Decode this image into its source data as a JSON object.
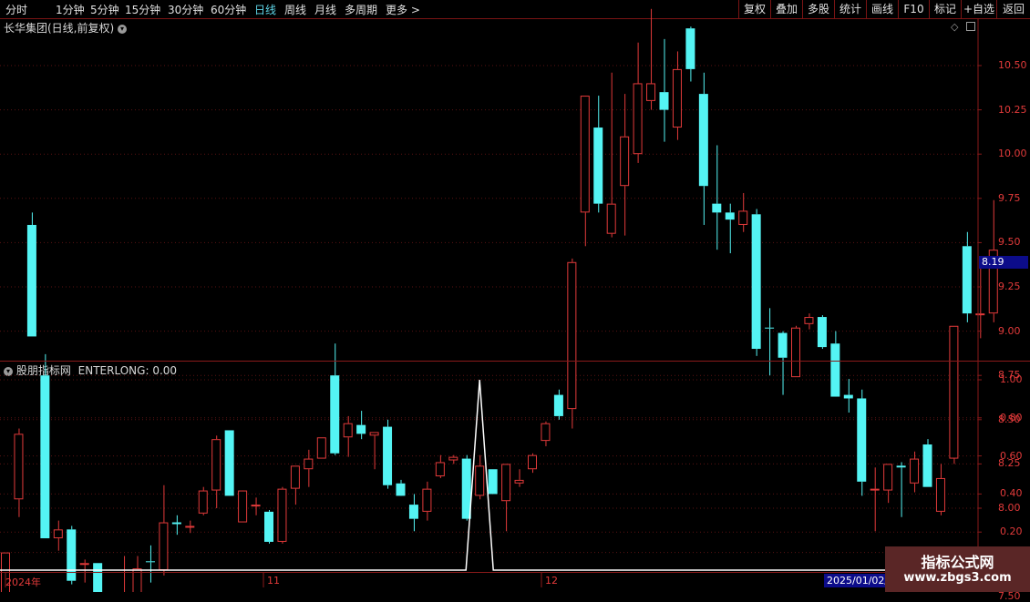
{
  "toolbar": {
    "periods": [
      "分时",
      "1分钟",
      "5分钟",
      "15分钟",
      "30分钟",
      "60分钟",
      "日线",
      "周线",
      "月线",
      "多周期",
      "更多 >"
    ],
    "active_period": "日线",
    "right_buttons": [
      "复权",
      "叠加",
      "多股",
      "统计",
      "画线",
      "F10",
      "标记",
      "+自选",
      "返回"
    ]
  },
  "main_panel": {
    "title": "长华集团(日线,前复权)",
    "current_price_tag": "8.19",
    "y_ticks": [
      "10.50",
      "10.25",
      "10.00",
      "9.75",
      "9.50",
      "9.25",
      "9.00",
      "8.75",
      "8.50",
      "8.25",
      "8.00",
      "7.75",
      "7.50"
    ]
  },
  "indicator_panel": {
    "title": "股朋指标网",
    "indicator_label": "ENTERLONG: 0.00",
    "y_ticks": [
      "1.00",
      "0.80",
      "0.60",
      "0.40",
      "0.20"
    ]
  },
  "x_axis": {
    "labels": [
      "2024年",
      "11",
      "12"
    ],
    "cursor_date": "2025/01/02/"
  },
  "watermark": {
    "line1": "指标公式网",
    "line2": "www.zbgs3.com"
  },
  "colors": {
    "up": "#e23a3a",
    "down": "#54f4f4",
    "signal": "#ffffff",
    "axis": "#8a1a1a"
  },
  "chart_data": [
    {
      "type": "candlestick",
      "title": "长华集团(日线,前复权)",
      "ylim": [
        7.3,
        10.8
      ],
      "candles": [
        {
          "o": 7.48,
          "h": 7.75,
          "l": 7.48,
          "c": 7.75,
          "up": true
        },
        {
          "o": 8.05,
          "h": 8.45,
          "l": 7.95,
          "c": 8.42,
          "up": true
        },
        {
          "o": 9.6,
          "h": 9.67,
          "l": 8.97,
          "c": 8.97,
          "up": false
        },
        {
          "o": 8.75,
          "h": 8.87,
          "l": 7.83,
          "c": 7.83,
          "up": false
        },
        {
          "o": 7.83,
          "h": 7.93,
          "l": 7.76,
          "c": 7.88,
          "up": true
        },
        {
          "o": 7.88,
          "h": 7.9,
          "l": 7.57,
          "c": 7.59,
          "up": false
        },
        {
          "o": 7.69,
          "h": 7.71,
          "l": 7.58,
          "c": 7.69,
          "up": true
        },
        {
          "o": 7.69,
          "h": 7.69,
          "l": 7.51,
          "c": 7.52,
          "up": false
        },
        {
          "o": 7.42,
          "h": 7.52,
          "l": 7.38,
          "c": 7.5,
          "up": true
        },
        {
          "o": 7.47,
          "h": 7.73,
          "l": 7.44,
          "c": 7.49,
          "up": true
        },
        {
          "o": 7.48,
          "h": 7.73,
          "l": 7.48,
          "c": 7.66,
          "up": true
        },
        {
          "o": 7.7,
          "h": 7.79,
          "l": 7.58,
          "c": 7.7,
          "up": false
        },
        {
          "o": 7.65,
          "h": 8.13,
          "l": 7.62,
          "c": 7.92,
          "up": true
        },
        {
          "o": 7.92,
          "h": 7.96,
          "l": 7.85,
          "c": 7.91,
          "up": false
        },
        {
          "o": 7.9,
          "h": 7.93,
          "l": 7.86,
          "c": 7.9,
          "up": true
        },
        {
          "o": 7.97,
          "h": 8.12,
          "l": 7.96,
          "c": 8.1,
          "up": true
        },
        {
          "o": 8.1,
          "h": 8.41,
          "l": 8.0,
          "c": 8.39,
          "up": true
        },
        {
          "o": 8.44,
          "h": 8.44,
          "l": 8.07,
          "c": 8.07,
          "up": false
        },
        {
          "o": 7.92,
          "h": 8.07,
          "l": 7.92,
          "c": 8.1,
          "up": true
        },
        {
          "o": 8.02,
          "h": 8.06,
          "l": 7.96,
          "c": 8.02,
          "up": true
        },
        {
          "o": 7.98,
          "h": 7.99,
          "l": 7.8,
          "c": 7.81,
          "up": false
        },
        {
          "o": 7.81,
          "h": 8.12,
          "l": 7.8,
          "c": 8.11,
          "up": true
        },
        {
          "o": 8.11,
          "h": 8.24,
          "l": 8.02,
          "c": 8.24,
          "up": true
        },
        {
          "o": 8.22,
          "h": 8.33,
          "l": 8.12,
          "c": 8.28,
          "up": true
        },
        {
          "o": 8.28,
          "h": 8.4,
          "l": 8.28,
          "c": 8.4,
          "up": true
        },
        {
          "o": 8.75,
          "h": 8.93,
          "l": 8.3,
          "c": 8.31,
          "up": false
        },
        {
          "o": 8.4,
          "h": 8.52,
          "l": 8.29,
          "c": 8.48,
          "up": true
        },
        {
          "o": 8.47,
          "h": 8.55,
          "l": 8.39,
          "c": 8.42,
          "up": false
        },
        {
          "o": 8.41,
          "h": 8.43,
          "l": 8.22,
          "c": 8.43,
          "up": true
        },
        {
          "o": 8.46,
          "h": 8.5,
          "l": 8.11,
          "c": 8.13,
          "up": false
        },
        {
          "o": 8.14,
          "h": 8.16,
          "l": 8.09,
          "c": 8.07,
          "up": false
        },
        {
          "o": 8.02,
          "h": 8.08,
          "l": 7.87,
          "c": 7.94,
          "up": false
        },
        {
          "o": 7.98,
          "h": 8.15,
          "l": 7.93,
          "c": 8.11,
          "up": true
        },
        {
          "o": 8.18,
          "h": 8.3,
          "l": 8.17,
          "c": 8.26,
          "up": true
        },
        {
          "o": 8.27,
          "h": 8.3,
          "l": 8.25,
          "c": 8.29,
          "up": true
        },
        {
          "o": 8.28,
          "h": 8.3,
          "l": 7.93,
          "c": 7.94,
          "up": false
        },
        {
          "o": 8.07,
          "h": 8.3,
          "l": 8.05,
          "c": 8.24,
          "up": true
        },
        {
          "o": 8.22,
          "h": 8.22,
          "l": 8.08,
          "c": 8.08,
          "up": false
        },
        {
          "o": 8.04,
          "h": 8.25,
          "l": 7.87,
          "c": 8.25,
          "up": true
        },
        {
          "o": 8.14,
          "h": 8.22,
          "l": 8.12,
          "c": 8.16,
          "up": true
        },
        {
          "o": 8.22,
          "h": 8.31,
          "l": 8.2,
          "c": 8.3,
          "up": true
        },
        {
          "o": 8.38,
          "h": 8.49,
          "l": 8.35,
          "c": 8.48,
          "up": true
        },
        {
          "o": 8.64,
          "h": 8.67,
          "l": 8.5,
          "c": 8.52,
          "up": false
        },
        {
          "o": 8.56,
          "h": 9.41,
          "l": 8.45,
          "c": 9.39,
          "up": true
        },
        {
          "o": 9.67,
          "h": 10.3,
          "l": 9.48,
          "c": 10.33,
          "up": true
        },
        {
          "o": 10.15,
          "h": 10.33,
          "l": 9.67,
          "c": 9.72,
          "up": false
        },
        {
          "o": 9.55,
          "h": 10.46,
          "l": 9.53,
          "c": 9.72,
          "up": true
        },
        {
          "o": 9.82,
          "h": 10.34,
          "l": 9.54,
          "c": 10.1,
          "up": true
        },
        {
          "o": 10.0,
          "h": 10.63,
          "l": 9.95,
          "c": 10.4,
          "up": true
        },
        {
          "o": 10.3,
          "h": 10.82,
          "l": 10.25,
          "c": 10.4,
          "up": true
        },
        {
          "o": 10.35,
          "h": 10.65,
          "l": 10.07,
          "c": 10.25,
          "up": false
        },
        {
          "o": 10.15,
          "h": 10.58,
          "l": 10.08,
          "c": 10.48,
          "up": true
        },
        {
          "o": 10.71,
          "h": 10.72,
          "l": 10.41,
          "c": 10.48,
          "up": false
        },
        {
          "o": 10.34,
          "h": 10.46,
          "l": 9.6,
          "c": 9.82,
          "up": false
        },
        {
          "o": 9.72,
          "h": 10.05,
          "l": 9.46,
          "c": 9.67,
          "up": false
        },
        {
          "o": 9.67,
          "h": 9.72,
          "l": 9.44,
          "c": 9.63,
          "up": false
        },
        {
          "o": 9.6,
          "h": 9.78,
          "l": 9.56,
          "c": 9.68,
          "up": true
        },
        {
          "o": 9.66,
          "h": 9.69,
          "l": 8.86,
          "c": 8.9,
          "up": false
        },
        {
          "o": 9.02,
          "h": 9.13,
          "l": 8.75,
          "c": 9.02,
          "up": false
        },
        {
          "o": 8.99,
          "h": 9.0,
          "l": 8.64,
          "c": 8.85,
          "up": false
        },
        {
          "o": 8.74,
          "h": 9.03,
          "l": 8.74,
          "c": 9.02,
          "up": true
        },
        {
          "o": 9.04,
          "h": 9.1,
          "l": 9.01,
          "c": 9.08,
          "up": true
        },
        {
          "o": 9.08,
          "h": 9.09,
          "l": 8.9,
          "c": 8.91,
          "up": false
        },
        {
          "o": 8.93,
          "h": 9.0,
          "l": 8.64,
          "c": 8.63,
          "up": false
        },
        {
          "o": 8.64,
          "h": 8.73,
          "l": 8.54,
          "c": 8.62,
          "up": false
        },
        {
          "o": 8.62,
          "h": 8.67,
          "l": 8.07,
          "c": 8.15,
          "up": false
        },
        {
          "o": 8.11,
          "h": 8.23,
          "l": 7.87,
          "c": 8.11,
          "up": true
        },
        {
          "o": 8.1,
          "h": 8.24,
          "l": 8.03,
          "c": 8.25,
          "up": true
        },
        {
          "o": 8.24,
          "h": 8.26,
          "l": 7.95,
          "c": 8.23,
          "up": false
        },
        {
          "o": 8.14,
          "h": 8.32,
          "l": 8.09,
          "c": 8.28,
          "up": true
        },
        {
          "o": 8.36,
          "h": 8.39,
          "l": 8.12,
          "c": 8.12,
          "up": false
        },
        {
          "o": 7.98,
          "h": 8.25,
          "l": 7.96,
          "c": 8.17,
          "up": true
        },
        {
          "o": 8.28,
          "h": 9.03,
          "l": 8.25,
          "c": 9.03,
          "up": true
        },
        {
          "o": 9.48,
          "h": 9.56,
          "l": 9.05,
          "c": 9.1,
          "up": false
        },
        {
          "o": 9.1,
          "h": 9.4,
          "l": 8.96,
          "c": 9.1,
          "up": true
        },
        {
          "o": 9.1,
          "h": 9.74,
          "l": 9.05,
          "c": 9.46,
          "up": true
        }
      ]
    },
    {
      "type": "line",
      "series": [
        {
          "name": "ENTERLONG",
          "values": [
            0,
            0,
            0,
            0,
            0,
            0,
            0,
            0,
            0,
            0,
            0,
            0,
            0,
            0,
            0,
            0,
            0,
            0,
            0,
            0,
            0,
            0,
            0,
            0,
            0,
            0,
            0,
            0,
            0,
            0,
            0,
            0,
            0,
            0,
            0,
            0,
            1,
            0,
            0,
            0,
            0,
            0,
            0,
            0,
            0,
            0,
            0,
            0,
            0,
            0,
            0,
            0,
            0,
            0,
            0,
            0,
            0,
            0,
            0,
            0,
            0,
            0,
            0,
            0,
            0,
            0,
            0,
            0,
            0,
            0,
            0,
            0,
            0,
            0,
            0,
            0
          ]
        }
      ],
      "ylim": [
        0,
        1.05
      ],
      "y_ticks": [
        1.0,
        0.8,
        0.6,
        0.4,
        0.2
      ]
    }
  ]
}
